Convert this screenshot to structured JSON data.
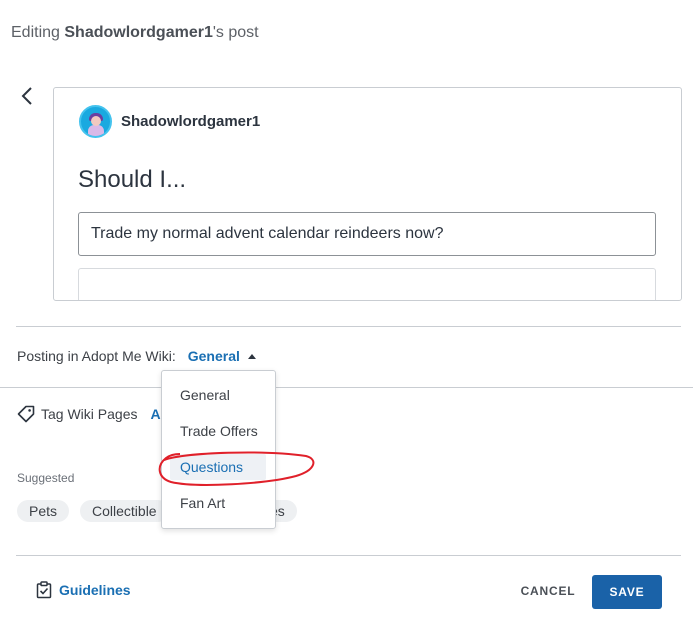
{
  "header": {
    "prefix": "Editing ",
    "username": "Shadowlordgamer1",
    "suffix": "'s post"
  },
  "post": {
    "author": "Shadowlordgamer1",
    "title": "Should I...",
    "poll_options": [
      "Trade my normal advent calendar reindeers now?",
      ""
    ]
  },
  "posting": {
    "label": "Posting in Adopt Me Wiki:",
    "selected_category": "General"
  },
  "tags": {
    "label": "Tag Wiki Pages",
    "add_label": "Ac"
  },
  "suggested": {
    "label": "Suggested",
    "chips": [
      "Pets",
      "Collectible",
      "es"
    ]
  },
  "category_menu": {
    "items": [
      "General",
      "Trade Offers",
      "Questions",
      "Fan Art"
    ],
    "selected": "Questions"
  },
  "footer": {
    "guidelines_label": "Guidelines",
    "cancel_label": "CANCEL",
    "save_label": "SAVE"
  },
  "colors": {
    "accent": "#1a6fb3",
    "save_button": "#1a62a8",
    "annotation": "#e0202a"
  },
  "icons": {
    "back": "chevron-left-icon",
    "tag": "tag-icon",
    "guidelines": "clipboard-check-icon"
  }
}
